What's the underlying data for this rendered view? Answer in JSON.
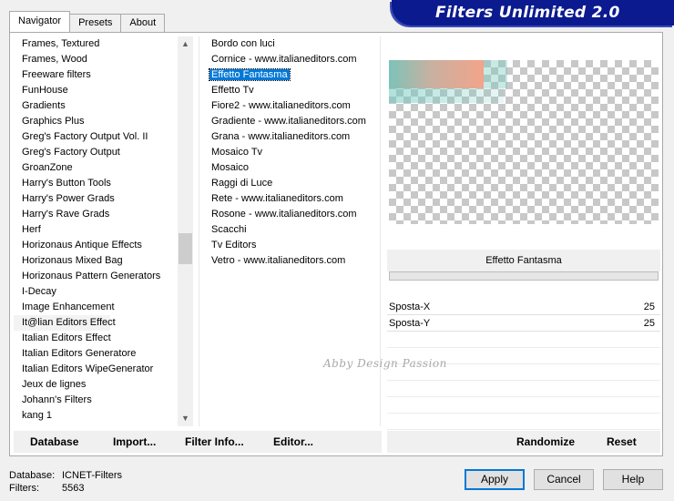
{
  "tabs": [
    "Navigator",
    "Presets",
    "About"
  ],
  "banner_title": "Filters Unlimited 2.0",
  "categories": [
    "Frames, Textured",
    "Frames, Wood",
    "Freeware filters",
    "FunHouse",
    "Gradients",
    "Graphics Plus",
    "Greg's Factory Output Vol. II",
    "Greg's Factory Output",
    "GroanZone",
    "Harry's Button Tools",
    "Harry's Power Grads",
    "Harry's Rave Grads",
    "Herf",
    "Horizonaus Antique Effects",
    "Horizonaus Mixed Bag",
    "Horizonaus Pattern Generators",
    "I-Decay",
    "Image Enhancement",
    "It@lian Editors Effect",
    "Italian Editors Effect",
    "Italian Editors Generatore",
    "Italian Editors WipeGenerator",
    "Jeux de lignes",
    "Johann's Filters",
    "kang 1"
  ],
  "filters": [
    "Bordo con luci",
    "Cornice - www.italianeditors.com",
    "Effetto Fantasma",
    "Effetto Tv",
    "Fiore2 - www.italianeditors.com",
    "Gradiente - www.italianeditors.com",
    "Grana - www.italianeditors.com",
    "Mosaico Tv",
    "Mosaico",
    "Raggi di Luce",
    "Rete - www.italianeditors.com",
    "Rosone - www.italianeditors.com",
    "Scacchi",
    "Tv Editors",
    "Vetro - www.italianeditors.com"
  ],
  "selected_filter": "Effetto Fantasma",
  "params": [
    {
      "name": "Sposta-X",
      "value": "25"
    },
    {
      "name": "Sposta-Y",
      "value": "25"
    }
  ],
  "watermark": "Abby Design Passion",
  "buttons": {
    "database": "Database",
    "import": "Import...",
    "filter_info": "Filter Info...",
    "editor": "Editor...",
    "randomize": "Randomize",
    "reset": "Reset",
    "apply": "Apply",
    "cancel": "Cancel",
    "help": "Help"
  },
  "status": {
    "database_label": "Database:",
    "database_value": "ICNET-Filters",
    "filters_label": "Filters:",
    "filters_value": "5563"
  },
  "colors": {
    "banner": "#0b1a8f",
    "selection": "#0078d7"
  }
}
